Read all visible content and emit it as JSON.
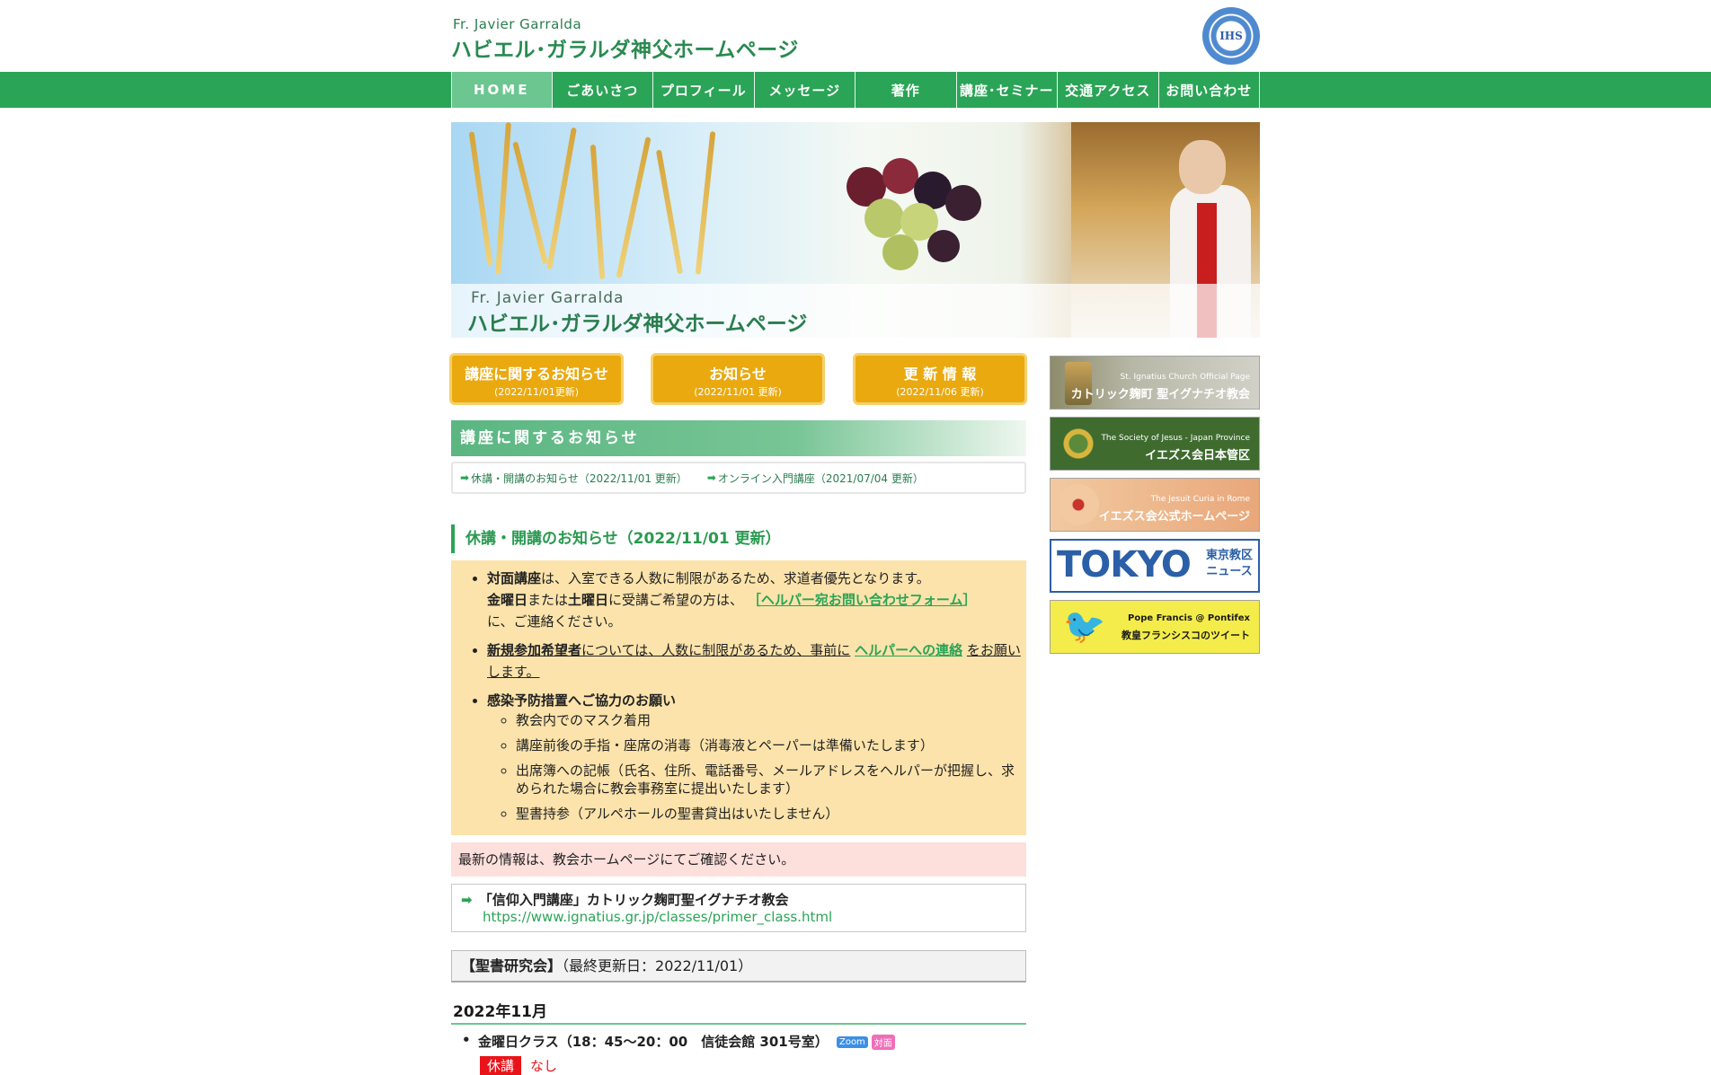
{
  "header": {
    "subtitle": "Fr. Javier Garralda",
    "title": "ハビエル･ガラルダ神父ホームページ",
    "seal_text": "IHS"
  },
  "nav": {
    "items": [
      "HOME",
      "ごあいさつ",
      "プロフィール",
      "メッセージ",
      "著作",
      "講座･セミナー",
      "交通アクセス",
      "お問い合わせ"
    ]
  },
  "hero": {
    "subtitle": "Fr. Javier Garralda",
    "title": "ハビエル･ガラルダ神父ホームページ"
  },
  "notices": [
    {
      "title": "講座に関するお知らせ",
      "date": "(2022/11/01更新)"
    },
    {
      "title": "お知らせ",
      "date": "(2022/11/01 更新)"
    },
    {
      "title": "更 新 情 報",
      "date": "(2022/11/06 更新)"
    }
  ],
  "section": {
    "heading": "講座に関するお知らせ",
    "links": [
      "休講・開講のお知らせ（2022/11/01 更新）",
      "オンライン入門講座（2021/07/04 更新）"
    ],
    "sub_heading": "休講・開講のお知らせ（2022/11/01 更新）"
  },
  "info": {
    "item1_bold": "対面講座",
    "item1_rest": "は、入室できる人数に制限があるため、求道者優先となります。",
    "item1_line2_a": "金曜日",
    "item1_line2_b": "または",
    "item1_line2_c": "土曜日",
    "item1_line2_d": "に受講ご希望の方は、",
    "item1_open": "［",
    "item1_link": "ヘルパー宛お問い合わせフォーム",
    "item1_close": "］",
    "item1_line3": "に、ご連絡ください。",
    "item2_bold": "新規参加希望者",
    "item2_rest": "については、人数に制限があるため、事前に",
    "item2_link": "ヘルパーへの連絡",
    "item2_tail": "をお願いします。",
    "item3_bold": "感染予防措置へご協力のお願い",
    "sub_items": [
      "教会内でのマスク着用",
      "講座前後の手指・座席の消毒（消毒液とペーパーは準備いたします）",
      "出席簿への記帳（氏名、住所、電話番号、メールアドレスをヘルパーが把握し、求められた場合に教会事務室に提出いたします）",
      "聖書持参（アルペホールの聖書貸出はいたしません）"
    ]
  },
  "pink_notice": "最新の情報は、教会ホームページにてご確認ください。",
  "church": {
    "title": "「信仰入門講座」カトリック麹町聖イグナチオ教会",
    "url": "https://www.ignatius.gr.jp/classes/primer_class.html"
  },
  "bible": {
    "title": "【聖書研究会】",
    "updated": "（最終更新日：2022/11/01）"
  },
  "schedule": {
    "month": "2022年11月",
    "class_line": "金曜日クラス（18：45～20：00　信徒会館 301号室）",
    "tag_zoom": "Zoom",
    "tag_face": "対面",
    "closure_label": "休講",
    "closure_value": "なし"
  },
  "sidebar": {
    "banners": [
      {
        "line1": "St. Ignatius Church Official Page",
        "line2": "カトリック麹町 聖イグナチオ教会"
      },
      {
        "line1": "The Society of Jesus - Japan Province",
        "line2": "イエズス会日本管区"
      },
      {
        "line1": "The Jesuit Curia in Rome",
        "line2": "イエズス会公式ホームページ"
      },
      {
        "line1": "TOKYO",
        "line2": "東京教区",
        "line3": "ニュース"
      },
      {
        "line1": "Pope Francis @ Pontifex",
        "line2": "教皇フランシスコのツイート"
      }
    ]
  },
  "colors": {
    "nav_green": "#2aa456",
    "notice_orange": "#eaa90f",
    "info_yellow": "#fbe3ab",
    "pink": "#fde0dc",
    "closure_red": "#e8141a"
  }
}
